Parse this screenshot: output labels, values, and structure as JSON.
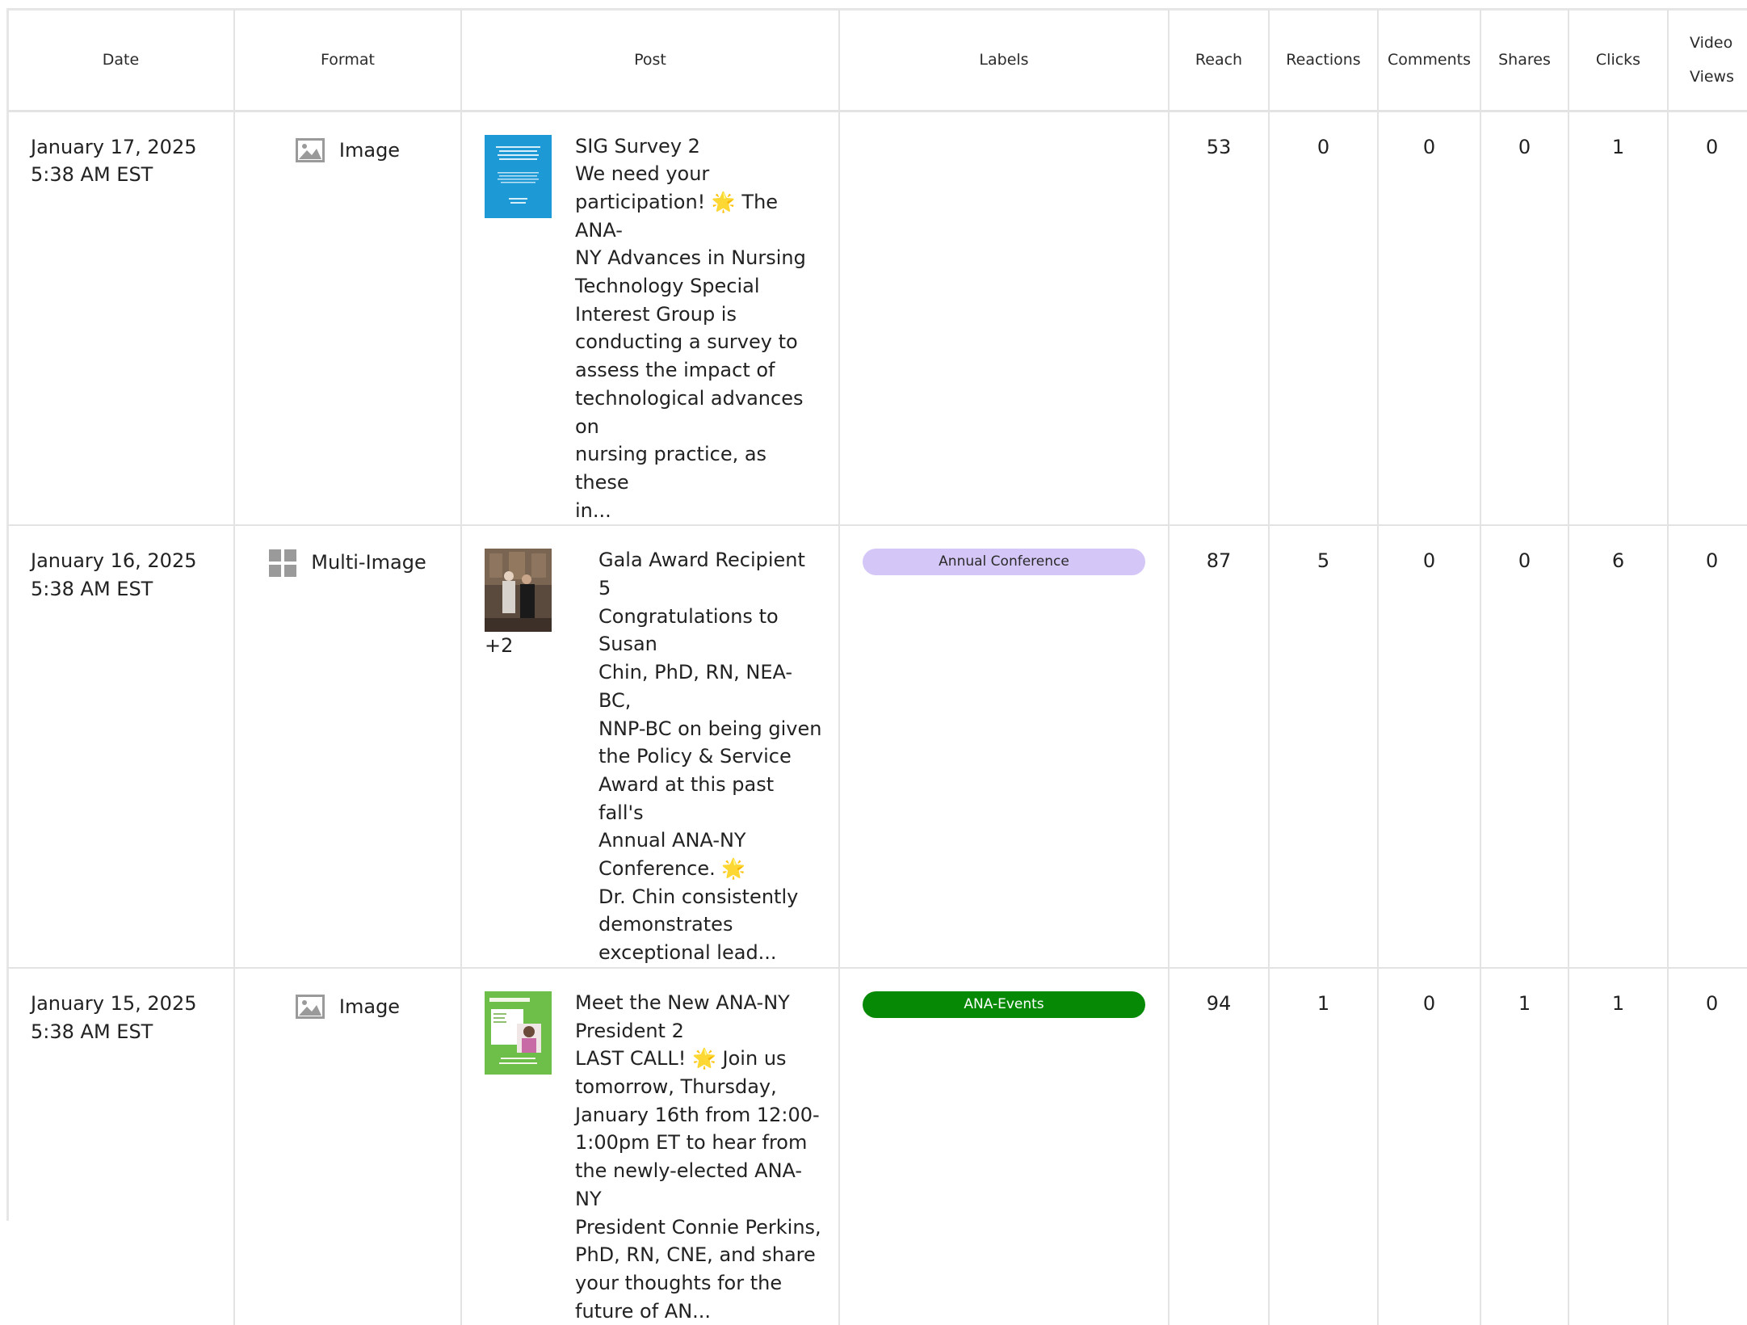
{
  "columns": {
    "date": "Date",
    "format": "Format",
    "post": "Post",
    "labels": "Labels",
    "reach": "Reach",
    "reactions": "Reactions",
    "comments": "Comments",
    "shares": "Shares",
    "clicks": "Clicks",
    "video_views_line1": "Video",
    "video_views_line2": "Views"
  },
  "rows": [
    {
      "date": "January 17, 2025",
      "time": "5:38 AM EST",
      "format": "Image",
      "format_icon": "image-icon",
      "post_lines": [
        "SIG Survey 2",
        "We need your",
        "participation! 🌟 The ANA-",
        "NY Advances in Nursing",
        "Technology Special",
        "Interest Group is",
        "conducting a survey to",
        "assess the impact of",
        "technological advances on",
        "nursing practice, as these",
        "in..."
      ],
      "extra_images": "",
      "label": "",
      "reach": "53",
      "reactions": "0",
      "comments": "0",
      "shares": "0",
      "clicks": "1",
      "video_views": "0"
    },
    {
      "date": "January 16, 2025",
      "time": "5:38 AM EST",
      "format": "Multi-Image",
      "format_icon": "grid-icon",
      "post_lines": [
        "Gala Award Recipient 5",
        "Congratulations to Susan",
        "Chin, PhD, RN, NEA-BC,",
        "NNP-BC on being given",
        "the Policy & Service",
        "Award at this past fall's",
        "Annual ANA-NY",
        "Conference. 🌟",
        "Dr. Chin consistently",
        "demonstrates",
        "exceptional lead..."
      ],
      "extra_images": "+2",
      "label": "Annual Conference",
      "label_color": "#d4c7f7",
      "reach": "87",
      "reactions": "5",
      "comments": "0",
      "shares": "0",
      "clicks": "6",
      "video_views": "0"
    },
    {
      "date": "January 15, 2025",
      "time": "5:38 AM EST",
      "format": "Image",
      "format_icon": "image-icon",
      "post_lines": [
        "Meet the New ANA-NY",
        "President 2",
        "LAST CALL! 🌟 Join us",
        "tomorrow, Thursday,",
        "January 16th from 12:00-",
        "1:00pm ET to hear from",
        "the newly-elected ANA-NY",
        "President Connie Perkins,",
        "PhD, RN, CNE, and share",
        "your thoughts for the",
        "future of AN..."
      ],
      "extra_images": "",
      "label": "ANA-Events",
      "label_color": "#068a06",
      "reach": "94",
      "reactions": "1",
      "comments": "0",
      "shares": "1",
      "clicks": "1",
      "video_views": "0"
    }
  ]
}
